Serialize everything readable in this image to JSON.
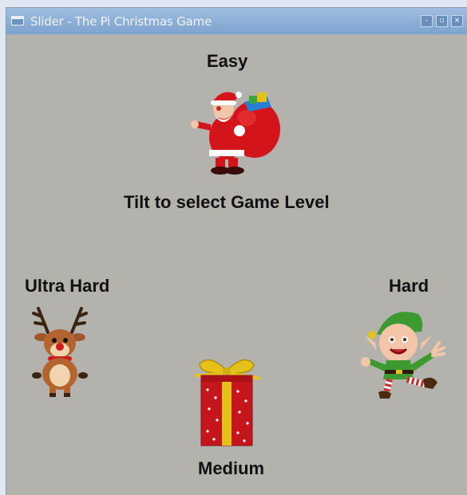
{
  "window": {
    "title": "Slider - The Pi Christmas Game",
    "controls": {
      "minimize": "-",
      "maximize": "▫",
      "close": "×"
    }
  },
  "levels": {
    "easy": {
      "label": "Easy",
      "icon": "santa-icon"
    },
    "medium": {
      "label": "Medium",
      "icon": "present-icon"
    },
    "hard": {
      "label": "Hard",
      "icon": "elf-icon"
    },
    "ultra_hard": {
      "label": "Ultra Hard",
      "icon": "reindeer-icon"
    }
  },
  "instruction": "Tilt to select Game Level",
  "colors": {
    "background": "#b3b2ad",
    "titlebar": "#86a9d3",
    "text": "#111111"
  }
}
